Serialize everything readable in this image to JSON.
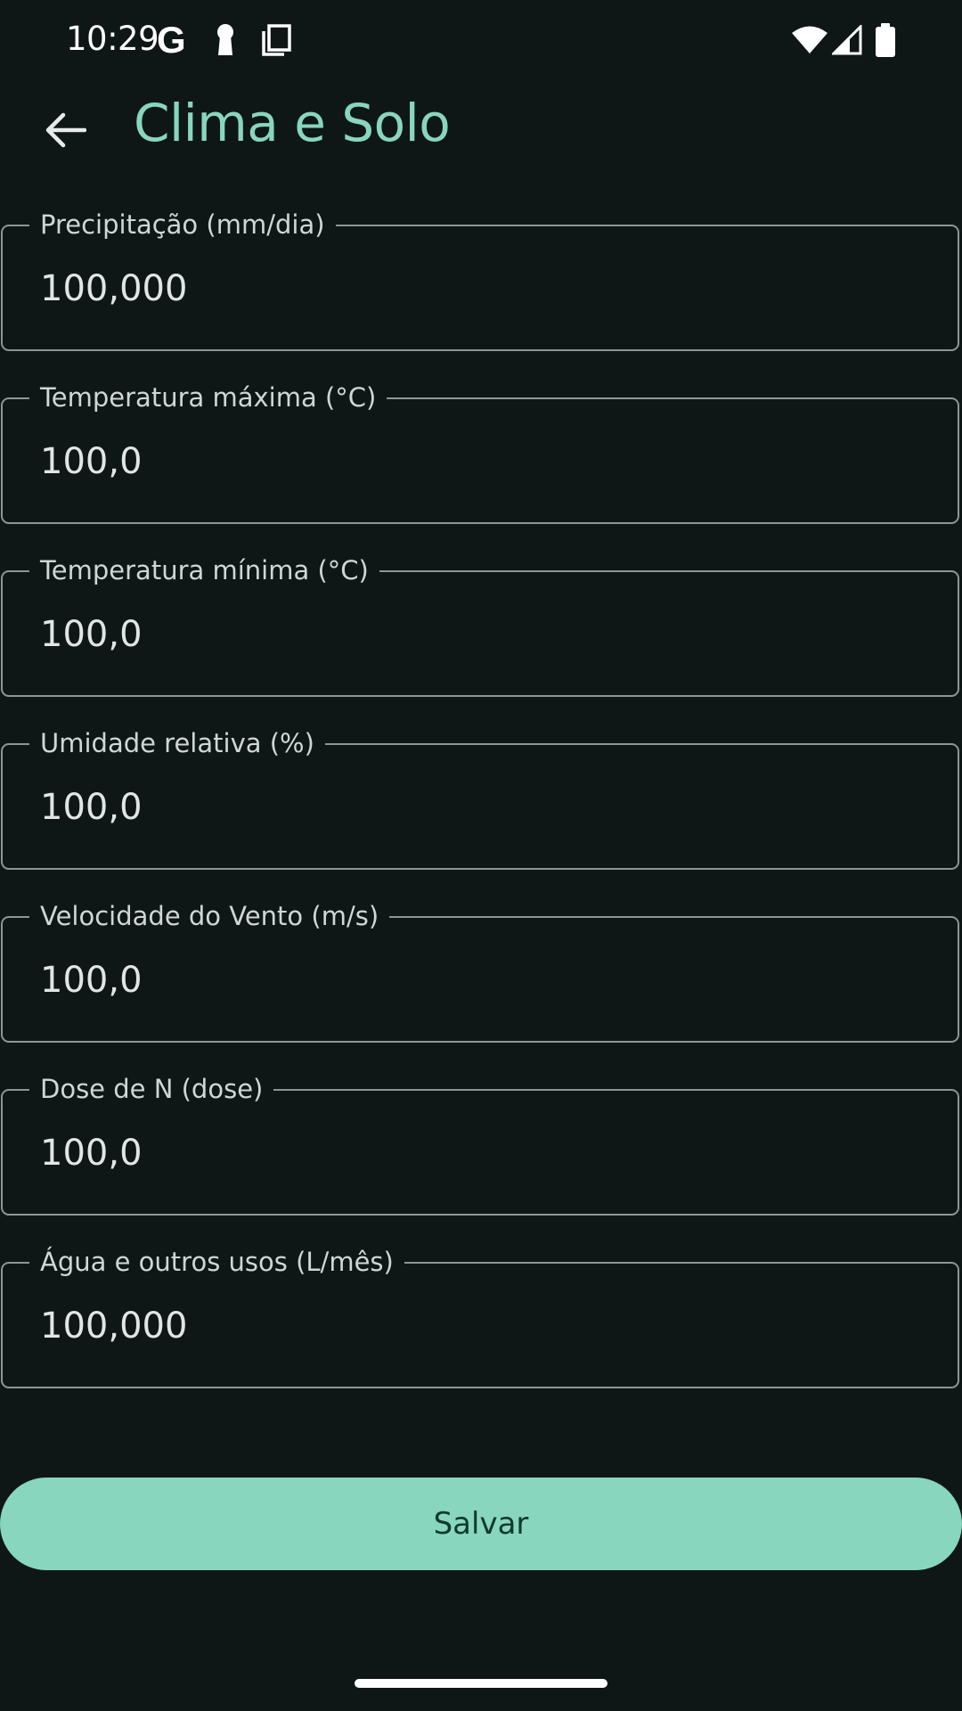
{
  "status_bar": {
    "time": "10:29",
    "google_glyph": "G",
    "icons_left": [
      "google-icon",
      "keyhole-icon",
      "screenshot-icon"
    ],
    "icons_right": [
      "wifi-icon",
      "cell-signal-icon",
      "battery-icon"
    ]
  },
  "app_bar": {
    "back_icon": "arrow-back-icon",
    "title": "Clima e Solo",
    "title_color": "#88d6bd"
  },
  "fields": [
    {
      "label": "Precipitação (mm/dia)",
      "value": "100,000"
    },
    {
      "label": "Temperatura máxima (°C)",
      "value": "100,0"
    },
    {
      "label": "Temperatura mínima (°C)",
      "value": "100,0"
    },
    {
      "label": "Umidade relativa (%)",
      "value": "100,0"
    },
    {
      "label": "Velocidade do Vento (m/s)",
      "value": "100,0"
    },
    {
      "label": "Dose de N (dose)",
      "value": "100,0"
    },
    {
      "label": "Água e outros usos (L/mês)",
      "value": "100,000"
    }
  ],
  "save_button": {
    "label": "Salvar",
    "background": "#88d6bd"
  },
  "colors": {
    "background": "#0f1716",
    "accent": "#88d6bd",
    "outline": "#8d9693"
  }
}
